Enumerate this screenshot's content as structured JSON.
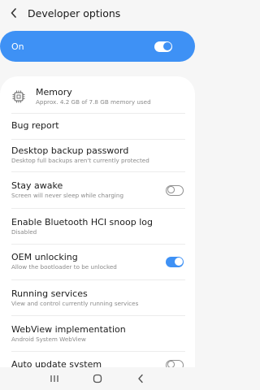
{
  "header": {
    "title": "Developer options",
    "back_icon": "back-chevron-icon"
  },
  "master_switch": {
    "label": "On",
    "state": "on"
  },
  "settings": {
    "items": [
      {
        "title": "Memory",
        "subtitle": "Approx. 4.2 GB of 7.8 GB memory used",
        "icon": "memory-chip-icon"
      },
      {
        "title": "Bug report"
      },
      {
        "title": "Desktop backup password",
        "subtitle": "Desktop full backups aren't currently protected"
      },
      {
        "title": "Stay awake",
        "subtitle": "Screen will never sleep while charging",
        "toggle": "off"
      },
      {
        "title": "Enable Bluetooth HCI snoop log",
        "subtitle": "Disabled"
      },
      {
        "title": "OEM unlocking",
        "subtitle": "Allow the bootloader to be unlocked",
        "toggle": "on"
      },
      {
        "title": "Running services",
        "subtitle": "View and control currently running services"
      },
      {
        "title": "WebView implementation",
        "subtitle": "Android System WebView"
      },
      {
        "title": "Auto update system",
        "toggle": "off"
      }
    ]
  },
  "nav": {
    "recents_icon": "recents-icon",
    "home_icon": "home-icon",
    "back_icon": "back-icon"
  }
}
